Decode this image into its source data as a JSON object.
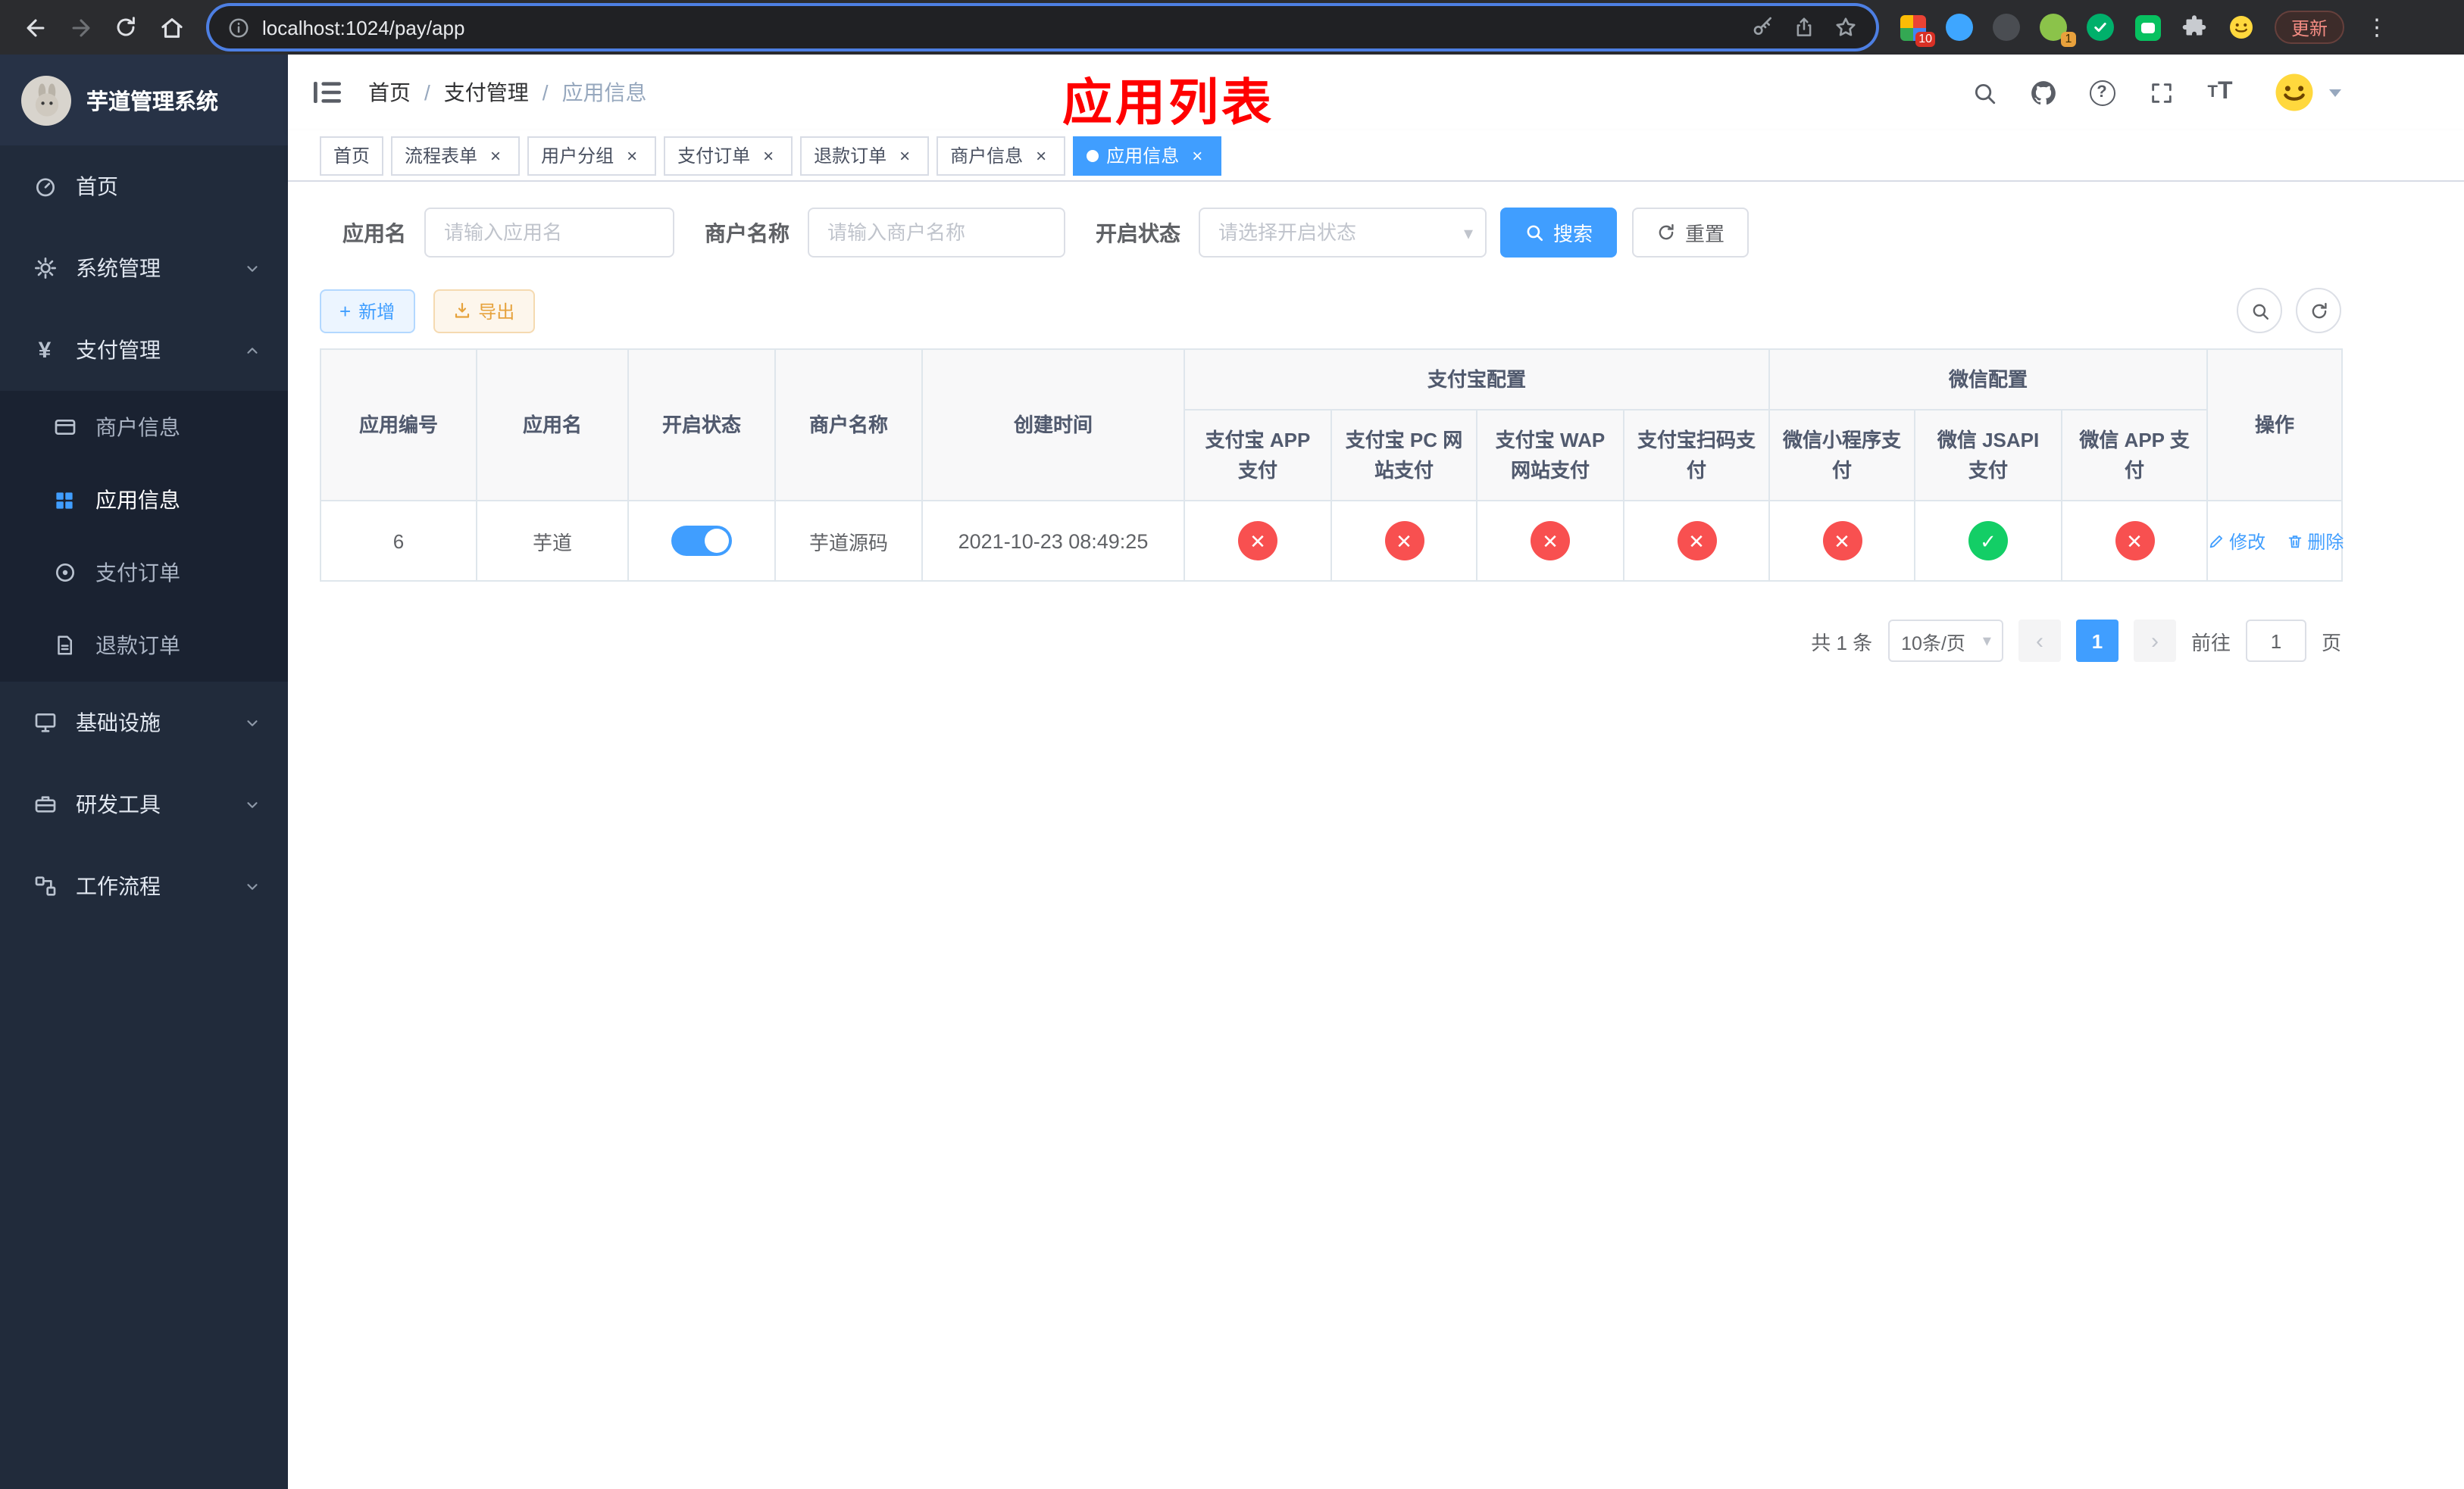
{
  "icons": {
    "menu_dots": "⋮",
    "help": "?",
    "yen": "¥",
    "prev": "‹",
    "next": "›",
    "caret_down": "▾",
    "plus": "+",
    "close": "×",
    "letter_t": "T"
  },
  "annotation": {
    "title": "应用列表"
  },
  "browser": {
    "url": "localhost:1024/pay/app",
    "update_button": "更新",
    "extension_badge_grid": "10",
    "extension_badge_avatar": "1"
  },
  "sidebar": {
    "app_title": "芋道管理系统",
    "items": {
      "home": "首页",
      "system": "系统管理",
      "payment": "支付管理",
      "infra": "基础设施",
      "devtools": "研发工具",
      "workflow": "工作流程"
    },
    "payment_children": {
      "merchant": "商户信息",
      "app": "应用信息",
      "order": "支付订单",
      "refund": "退款订单"
    }
  },
  "breadcrumb": {
    "home": "首页",
    "section": "支付管理",
    "current": "应用信息",
    "separator": "/"
  },
  "tabs": [
    {
      "label": "首页"
    },
    {
      "label": "流程表单"
    },
    {
      "label": "用户分组"
    },
    {
      "label": "支付订单"
    },
    {
      "label": "退款订单"
    },
    {
      "label": "商户信息"
    },
    {
      "label": "应用信息"
    }
  ],
  "filters": {
    "app_name_label": "应用名",
    "app_name_placeholder": "请输入应用名",
    "merchant_label": "商户名称",
    "merchant_placeholder": "请输入商户名称",
    "status_label": "开启状态",
    "status_placeholder": "请选择开启状态",
    "search_button": "搜索",
    "reset_button": "重置"
  },
  "toolbar": {
    "add_button": "新增",
    "export_button": "导出"
  },
  "table": {
    "headers": {
      "app_id": "应用编号",
      "app_name": "应用名",
      "status": "开启状态",
      "merchant": "商户名称",
      "create_time": "创建时间",
      "alipay_group": "支付宝配置",
      "wechat_group": "微信配置",
      "actions": "操作",
      "alipay_app": "支付宝 APP 支付",
      "alipay_pc": "支付宝 PC 网站支付",
      "alipay_wap": "支付宝 WAP 网站支付",
      "alipay_qr": "支付宝扫码支付",
      "wx_mini": "微信小程序支付",
      "wx_jsapi": "微信 JSAPI 支付",
      "wx_app": "微信 APP 支付"
    },
    "row": {
      "app_id": "6",
      "app_name": "芋道",
      "status_enabled": true,
      "merchant_name": "芋道源码",
      "create_time": "2021-10-23 08:49:25",
      "statuses": [
        false,
        false,
        false,
        false,
        false,
        true,
        false
      ],
      "edit_link": "修改",
      "delete_link": "删除"
    }
  },
  "pagination": {
    "total_text": "共 1 条",
    "page_size": "10条/页",
    "current_page": "1",
    "goto_label": "前往",
    "goto_value": "1",
    "page_unit": "页"
  },
  "colors": {
    "accent": "#409eff",
    "danger": "#f85050",
    "success": "#13ce66",
    "annotation_red": "#ff0000",
    "sidebar_bg": "#212b3b"
  }
}
